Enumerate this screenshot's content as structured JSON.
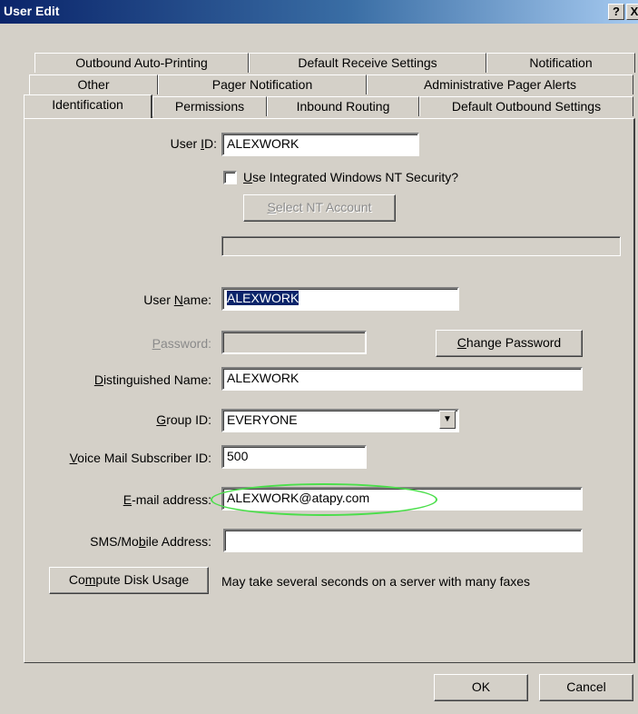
{
  "window": {
    "title": "User Edit",
    "help_glyph": "?",
    "close_glyph": "X"
  },
  "tabs": {
    "row1": [
      "Outbound Auto-Printing",
      "Default Receive Settings",
      "Notification"
    ],
    "row2": [
      "Other",
      "Pager Notification",
      "Administrative Pager Alerts"
    ],
    "row3": [
      "Identification",
      "Permissions",
      "Inbound Routing",
      "Default Outbound Settings"
    ],
    "selected": "Identification"
  },
  "form": {
    "user_id": {
      "label_pre": "User ",
      "label_key": "I",
      "label_post": "D:",
      "value": "ALEXWORK"
    },
    "integrated_nt": {
      "label_key": "U",
      "label_rest": "se Integrated Windows NT Security?",
      "checked": false
    },
    "select_nt_account": {
      "label_key": "S",
      "label_rest": "elect NT Account"
    },
    "user_name": {
      "label_pre": "User ",
      "label_key": "N",
      "label_post": "ame:",
      "value": "ALEXWORK"
    },
    "password": {
      "label_key": "P",
      "label_rest": "assword:",
      "value": ""
    },
    "change_password": {
      "label_key": "C",
      "label_rest": "hange Password"
    },
    "distinguished_name": {
      "label_key": "D",
      "label_rest": "istinguished Name:",
      "value": "ALEXWORK"
    },
    "group_id": {
      "label_key": "G",
      "label_rest": "roup ID:",
      "value": "EVERYONE"
    },
    "voice_mail_id": {
      "label_key": "V",
      "label_rest": "oice Mail Subscriber ID:",
      "value": "500"
    },
    "email": {
      "label_key": "E",
      "label_rest": "-mail address:",
      "value": "ALEXWORK@atapy.com"
    },
    "sms": {
      "label_pre": "SMS/Mo",
      "label_key": "b",
      "label_post": "ile Address:",
      "value": ""
    },
    "compute_disk": {
      "label_pre": "Co",
      "label_key": "m",
      "label_post": "pute Disk Usage"
    },
    "disk_note": "May take several seconds on a server with many faxes"
  },
  "footer": {
    "ok": "OK",
    "cancel": "Cancel"
  },
  "colors": {
    "title_start": "#0a246a",
    "title_end": "#a6caf0",
    "face": "#d4d0c8",
    "selection": "#0a246a",
    "highlight_ellipse": "#4ade4a"
  }
}
